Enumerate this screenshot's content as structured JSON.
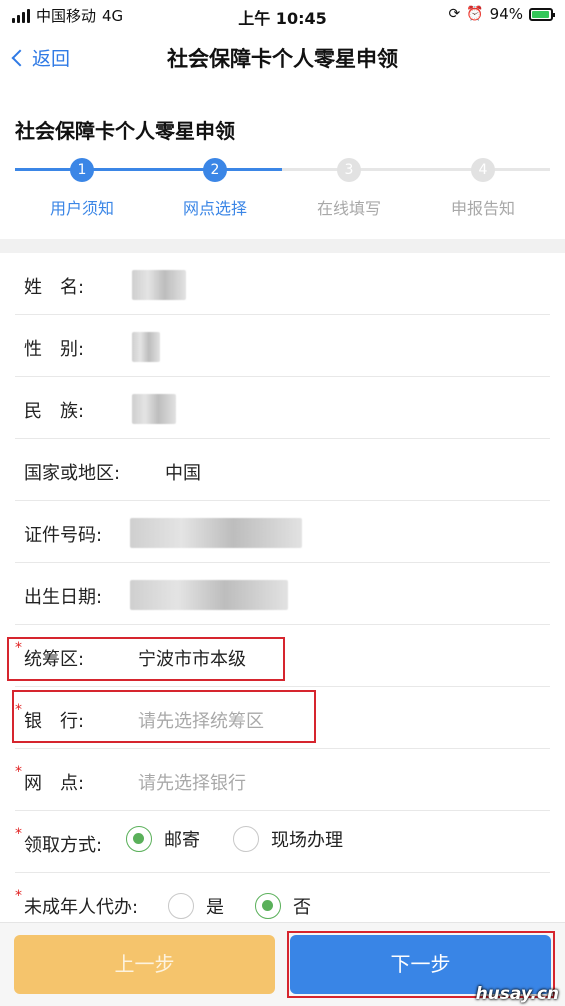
{
  "status_bar": {
    "carrier": "中国移动",
    "network": "4G",
    "time": "上午 10:45",
    "battery": "94%"
  },
  "nav": {
    "back_label": "返回",
    "title": "社会保障卡个人零星申领"
  },
  "section_title": "社会保障卡个人零星申领",
  "steps": [
    {
      "num": "1",
      "label": "用户须知",
      "state": "done"
    },
    {
      "num": "2",
      "label": "网点选择",
      "state": "current"
    },
    {
      "num": "3",
      "label": "在线填写",
      "state": "pending"
    },
    {
      "num": "4",
      "label": "申报告知",
      "state": "pending"
    }
  ],
  "form": {
    "name_label": "姓　名:",
    "gender_label": "性　别:",
    "ethnicity_label": "民　族:",
    "country_label": "国家或地区:",
    "country_value": "中国",
    "id_label": "证件号码:",
    "birth_label": "出生日期:",
    "required_mark": "*",
    "district_label": "统筹区:",
    "district_value": "宁波市市本级",
    "bank_label": "银　行:",
    "bank_placeholder": "请先选择统筹区",
    "branch_label": "网　点:",
    "branch_placeholder": "请先选择银行",
    "method_label": "领取方式:",
    "method_options": [
      "邮寄",
      "现场办理"
    ],
    "method_selected": "邮寄",
    "minor_label": "未成年人代办:",
    "minor_options": [
      "是",
      "否"
    ],
    "minor_selected": "否"
  },
  "buttons": {
    "prev": "上一步",
    "next": "下一步"
  },
  "watermark": "husay.cn",
  "colors": {
    "accent": "#3b86e6",
    "required": "#e02020",
    "radio_checked": "#5ab05a",
    "prev_button": "#f5c46c",
    "highlight_box": "#d6252e"
  }
}
